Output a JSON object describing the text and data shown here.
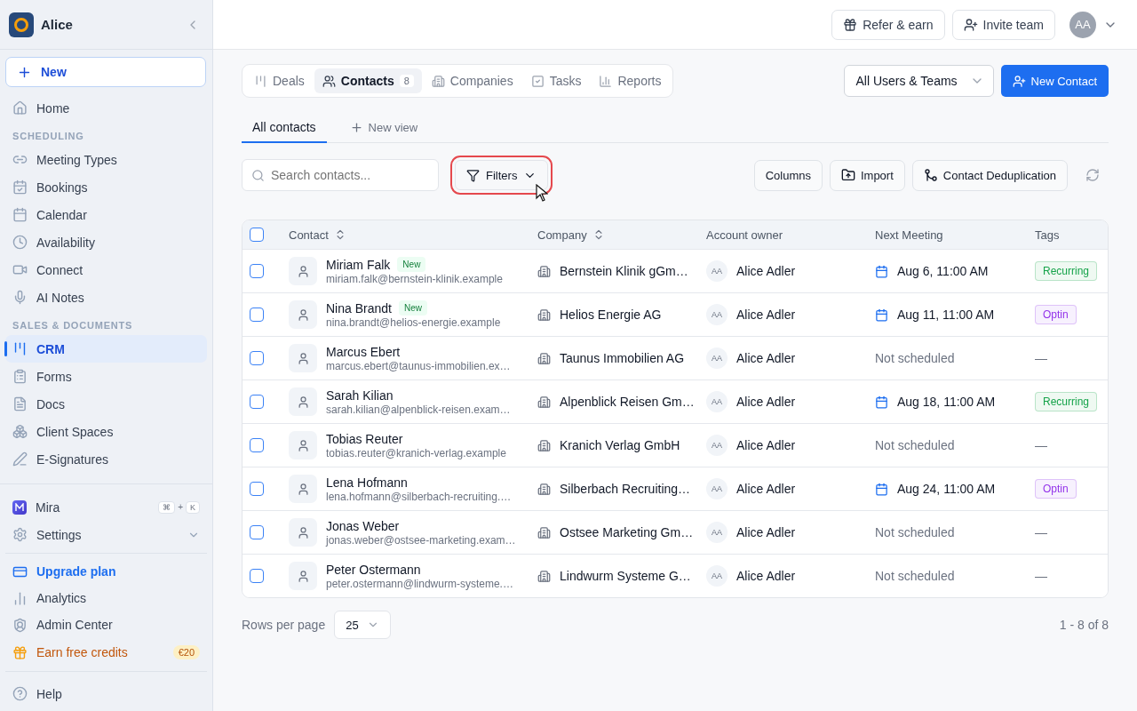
{
  "sidebar": {
    "workspace": "Alice",
    "new_button": "New",
    "nav": [
      {
        "kind": "link",
        "label": "Home",
        "selected": false
      },
      {
        "kind": "heading",
        "label": "SCHEDULING"
      },
      {
        "kind": "link",
        "label": "Meeting Types",
        "selected": false
      },
      {
        "kind": "link",
        "label": "Bookings",
        "selected": false
      },
      {
        "kind": "link",
        "label": "Calendar",
        "selected": false
      },
      {
        "kind": "link",
        "label": "Availability",
        "selected": false
      },
      {
        "kind": "link",
        "label": "Connect",
        "selected": false
      },
      {
        "kind": "link",
        "label": "AI Notes",
        "selected": false
      },
      {
        "kind": "heading",
        "label": "SALES & DOCUMENTS"
      },
      {
        "kind": "link",
        "label": "CRM",
        "selected": true
      },
      {
        "kind": "link",
        "label": "Forms",
        "selected": false
      },
      {
        "kind": "link",
        "label": "Docs",
        "selected": false
      },
      {
        "kind": "link",
        "label": "Client Spaces",
        "selected": false
      },
      {
        "kind": "link",
        "label": "E-Signatures",
        "selected": false
      }
    ],
    "assistant": {
      "label": "Mira",
      "keys": [
        "⌘",
        "K"
      ],
      "joiner": "+"
    },
    "settings": {
      "label": "Settings",
      "expanded": false
    },
    "links": [
      {
        "kind": "upgrade",
        "label": "Upgrade plan"
      },
      {
        "kind": "plain",
        "label": "Analytics"
      },
      {
        "kind": "plain",
        "label": "Admin Center"
      },
      {
        "kind": "promo",
        "label": "Earn free credits",
        "badge": "€20"
      }
    ],
    "help": "Help"
  },
  "header": {
    "buttons": [
      "Refer & earn",
      "Invite team"
    ],
    "avatar": "AA"
  },
  "tabs": [
    {
      "label": "Deals",
      "selected": false
    },
    {
      "label": "Contacts",
      "selected": true,
      "count": "8"
    },
    {
      "label": "Companies",
      "selected": false
    },
    {
      "label": "Tasks",
      "selected": false
    },
    {
      "label": "Reports",
      "selected": false
    }
  ],
  "owner_filter": "All Users & Teams",
  "new_contact": "New Contact",
  "views": [
    {
      "label": "All contacts",
      "selected": true
    }
  ],
  "new_view": "New view",
  "search": {
    "placeholder": "Search contacts..."
  },
  "filters": {
    "label": "Filters",
    "highlighted": true
  },
  "actions": [
    "Columns",
    "Import",
    "Contact Deduplication"
  ],
  "table": {
    "all_checked": false,
    "columns": [
      {
        "label": "Contact",
        "sortable": true
      },
      {
        "label": "Company",
        "sortable": true
      },
      {
        "label": "Account owner",
        "sortable": false
      },
      {
        "label": "Next Meeting",
        "sortable": false
      },
      {
        "label": "Tags",
        "sortable": false
      }
    ],
    "rows": [
      {
        "checked": false,
        "name": "Miriam Falk",
        "badge": "New",
        "email": "miriam.falk@bernstein-klinik.example",
        "company": "Bernstein Klinik gGm…",
        "owner_initials": "AA",
        "owner": "Alice Adler",
        "meeting": "Aug 6, 11:00 AM",
        "scheduled": true,
        "tag": {
          "kind": "pill",
          "label": "Recurring",
          "color": "#16a34a"
        }
      },
      {
        "checked": false,
        "name": "Nina Brandt",
        "badge": "New",
        "email": "nina.brandt@helios-energie.example",
        "company": "Helios Energie AG",
        "owner_initials": "AA",
        "owner": "Alice Adler",
        "meeting": "Aug 11, 11:00 AM",
        "scheduled": true,
        "tag": {
          "kind": "pill",
          "label": "Optin",
          "color": "#9333ea"
        }
      },
      {
        "checked": false,
        "name": "Marcus Ebert",
        "email": "marcus.ebert@taunus-immobilien.ex…",
        "company": "Taunus Immobilien AG",
        "owner_initials": "AA",
        "owner": "Alice Adler",
        "meeting": "Not scheduled",
        "scheduled": false,
        "tag": {
          "kind": "none",
          "label": "—"
        }
      },
      {
        "checked": false,
        "name": "Sarah Kilian",
        "email": "sarah.kilian@alpenblick-reisen.exam…",
        "company": "Alpenblick Reisen Gm…",
        "owner_initials": "AA",
        "owner": "Alice Adler",
        "meeting": "Aug 18, 11:00 AM",
        "scheduled": true,
        "tag": {
          "kind": "pill",
          "label": "Recurring",
          "color": "#16a34a"
        }
      },
      {
        "checked": false,
        "name": "Tobias Reuter",
        "email": "tobias.reuter@kranich-verlag.example",
        "company": "Kranich Verlag GmbH",
        "owner_initials": "AA",
        "owner": "Alice Adler",
        "meeting": "Not scheduled",
        "scheduled": false,
        "tag": {
          "kind": "none",
          "label": "—"
        }
      },
      {
        "checked": false,
        "name": "Lena Hofmann",
        "email": "lena.hofmann@silberbach-recruiting.…",
        "company": "Silberbach Recruiting…",
        "owner_initials": "AA",
        "owner": "Alice Adler",
        "meeting": "Aug 24, 11:00 AM",
        "scheduled": true,
        "tag": {
          "kind": "pill",
          "label": "Optin",
          "color": "#9333ea"
        }
      },
      {
        "checked": false,
        "name": "Jonas Weber",
        "email": "jonas.weber@ostsee-marketing.exam…",
        "company": "Ostsee Marketing Gm…",
        "owner_initials": "AA",
        "owner": "Alice Adler",
        "meeting": "Not scheduled",
        "scheduled": false,
        "tag": {
          "kind": "none",
          "label": "—"
        }
      },
      {
        "checked": false,
        "name": "Peter Ostermann",
        "email": "peter.ostermann@lindwurm-systeme.…",
        "company": "Lindwurm Systeme G…",
        "owner_initials": "AA",
        "owner": "Alice Adler",
        "meeting": "Not scheduled",
        "scheduled": false,
        "tag": {
          "kind": "none",
          "label": "—"
        }
      }
    ]
  },
  "pagination": {
    "label": "Rows per page",
    "value": "25",
    "range": "1 - 8 of 8"
  }
}
